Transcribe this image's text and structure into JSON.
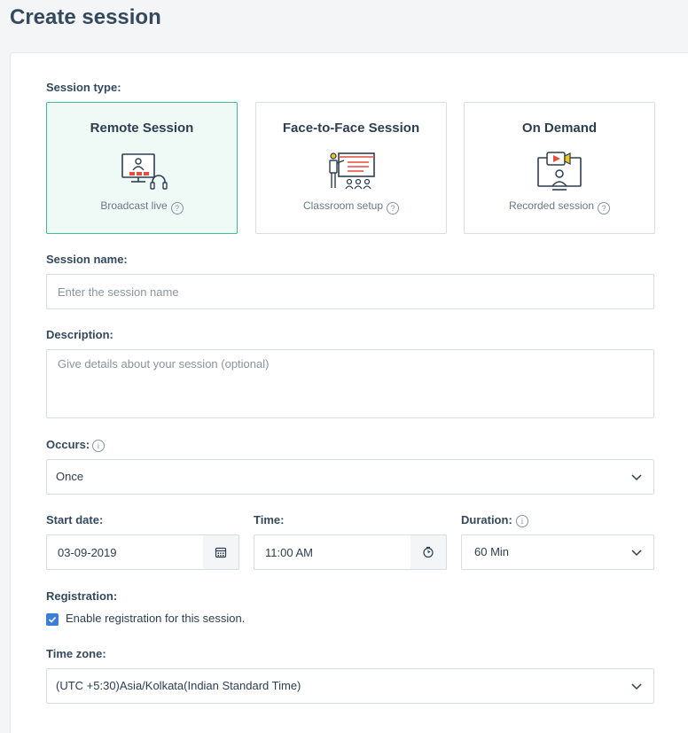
{
  "page": {
    "title": "Create session"
  },
  "session_type": {
    "label": "Session type:",
    "options": [
      {
        "title": "Remote Session",
        "subtitle": "Broadcast live",
        "icon": "remote-broadcast-illustration",
        "selected": true
      },
      {
        "title": "Face-to-Face Session",
        "subtitle": "Classroom setup",
        "icon": "classroom-illustration",
        "selected": false
      },
      {
        "title": "On Demand",
        "subtitle": "Recorded session",
        "icon": "recorded-video-illustration",
        "selected": false
      }
    ]
  },
  "session_name": {
    "label": "Session name:",
    "placeholder": "Enter the session name",
    "value": ""
  },
  "description": {
    "label": "Description:",
    "placeholder": "Give details about your session (optional)",
    "value": ""
  },
  "occurs": {
    "label": "Occurs:",
    "value": "Once"
  },
  "start_date": {
    "label": "Start date:",
    "value": "03-09-2019"
  },
  "time": {
    "label": "Time:",
    "value": "11:00 AM"
  },
  "duration": {
    "label": "Duration:",
    "value": "60 Min"
  },
  "registration": {
    "label": "Registration:",
    "checkbox_label": "Enable registration for this session.",
    "checked": true
  },
  "timezone": {
    "label": "Time zone:",
    "value": "(UTC +5:30)Asia/Kolkata(Indian Standard Time)"
  },
  "colors": {
    "accent_green": "#3fbf93",
    "selected_bg": "#effaf6",
    "checkbox_blue": "#3b7dd8",
    "illustration_red": "#e74c3c",
    "illustration_navy": "#2c3e50"
  }
}
